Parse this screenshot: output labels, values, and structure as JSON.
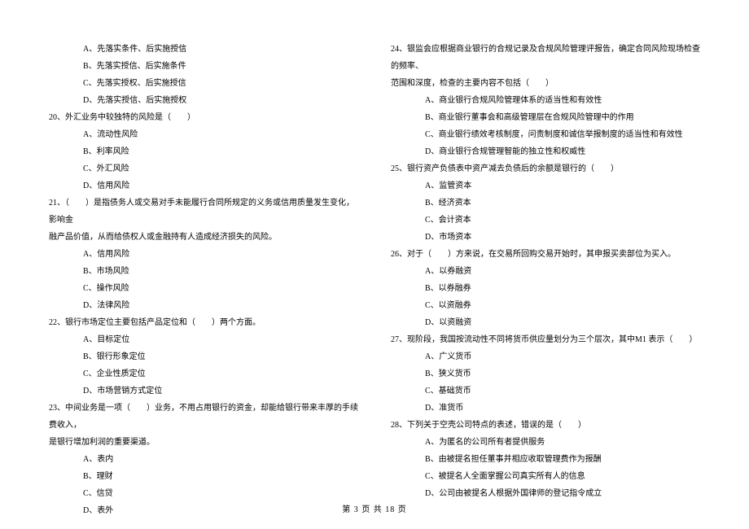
{
  "left": {
    "pre_options": [
      "A、先落实条件、后实施授信",
      "B、先落实授信、后实施条件",
      "C、先落实授权、后实施授信",
      "D、先落实授信、后实施授权"
    ],
    "questions": [
      {
        "num": "20、",
        "stem": "外汇业务中较独特的风险是（　　）",
        "options": [
          "A、流动性风险",
          "B、利率风险",
          "C、外汇风险",
          "D、信用风险"
        ]
      },
      {
        "num": "21、",
        "stem": "（　　）是指债务人或交易对手未能履行合同所规定的义务或信用质量发生变化，影响金",
        "cont": "融产品价值，从而给债权人或金融持有人造成经济损失的风险。",
        "options": [
          "A、信用风险",
          "B、市场风险",
          "C、操作风险",
          "D、法律风险"
        ]
      },
      {
        "num": "22、",
        "stem": "银行市场定位主要包括产品定位和（　　）两个方面。",
        "options": [
          "A、目标定位",
          "B、银行形象定位",
          "C、企业性质定位",
          "D、市场营销方式定位"
        ]
      },
      {
        "num": "23、",
        "stem": "中间业务是一项（　　）业务，不用占用银行的资金，却能给银行带来丰厚的手续费收入，",
        "cont": "是银行增加利润的重要渠道。",
        "options": [
          "A、表内",
          "B、理财",
          "C、信贷",
          "D、表外"
        ]
      }
    ]
  },
  "right": {
    "questions": [
      {
        "num": "24、",
        "stem": "银监会应根据商业银行的合规记录及合规风险管理评报告，确定合同风险现场检查的频率、",
        "cont": "范围和深度，检查的主要内容不包括（　　）",
        "options": [
          "A、商业银行合规风险管理体系的适当性和有效性",
          "B、商业银行董事会和高级管理层在合规风险管理中的作用",
          "C、商业银行绩效考核制度，问责制度和诚信举报制度的适当性和有效性",
          "D、商业银行合规管理智能的独立性和权威性"
        ]
      },
      {
        "num": "25、",
        "stem": "银行资产负债表中资产减去负债后的余额是银行的（　　）",
        "options": [
          "A、监管资本",
          "B、经济资本",
          "C、会计资本",
          "D、市场资本"
        ]
      },
      {
        "num": "26、",
        "stem": "对于（　　）方来说，在交易所回购交易开始时，其申报买卖部位为买入。",
        "options": [
          "A、以券融资",
          "B、以券融券",
          "C、以资融券",
          "D、以资融资"
        ]
      },
      {
        "num": "27、",
        "stem": "现阶段，我国按流动性不同将货币供应量划分为三个层次，其中M1 表示（　　）",
        "options": [
          "A、广义货币",
          "B、狭义货币",
          "C、基础货币",
          "D、准货币"
        ]
      },
      {
        "num": "28、",
        "stem": "下列关于空壳公司特点的表述，错误的是（　　）",
        "options": [
          "A、为匿名的公司所有者提供服务",
          "B、由被提名担任董事并相应收取管理费作为报酬",
          "C、被提名人全面掌握公司真实所有人的信息",
          "D、公司由被提名人根据外国律师的登记指令成立"
        ]
      }
    ]
  },
  "footer": "第 3 页 共 18 页"
}
